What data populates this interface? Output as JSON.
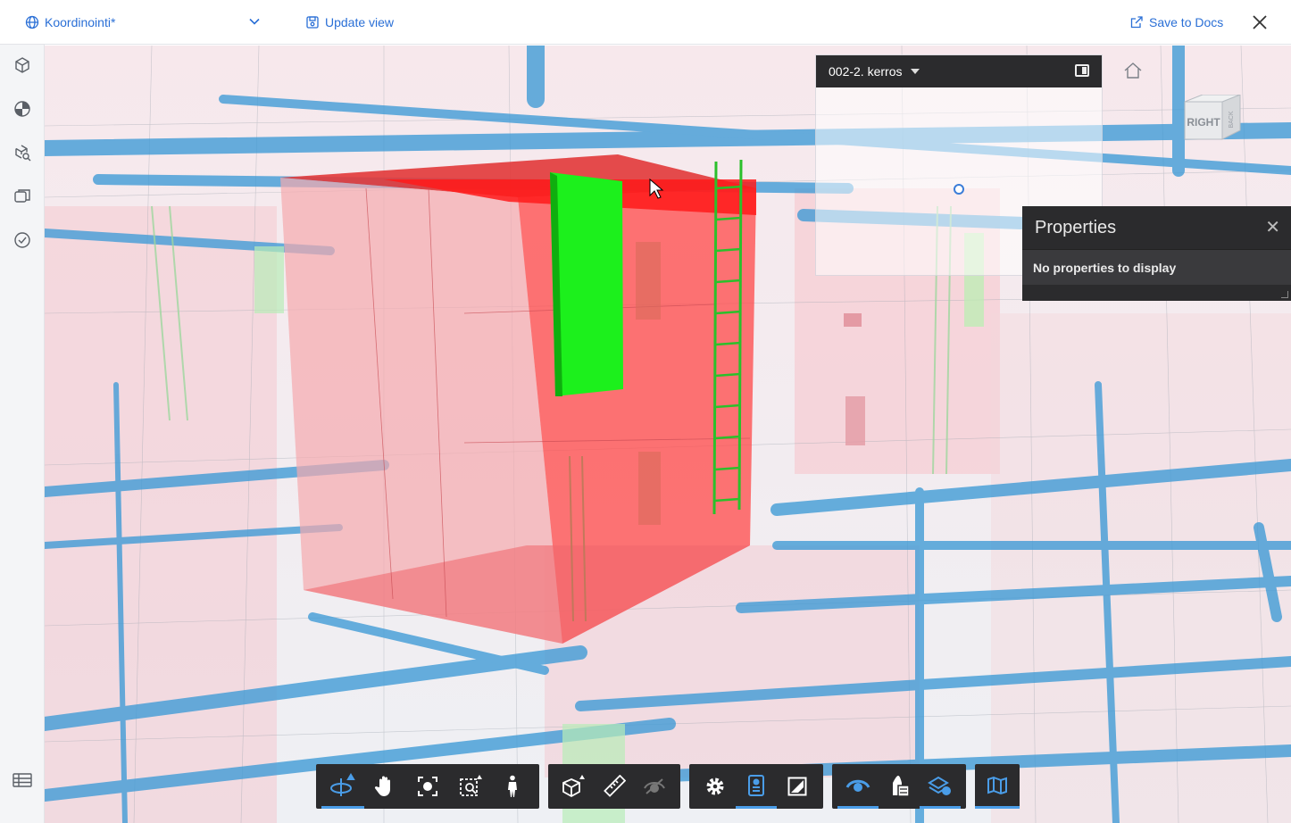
{
  "header": {
    "view_name": "Koordinointi*",
    "update_view_label": "Update view",
    "save_to_docs_label": "Save to Docs"
  },
  "minimap": {
    "level": "002-2. kerros"
  },
  "viewcube": {
    "front_label": "RIGHT",
    "side_label": "BACK"
  },
  "properties": {
    "title": "Properties",
    "empty_message": "No properties to display"
  },
  "sidebar": {
    "icons": [
      "model-cube-icon",
      "sphere-icon",
      "model-search-icon",
      "layers-icon",
      "check-circle-icon",
      "table-icon"
    ]
  },
  "toolbar": {
    "groups": [
      [
        "orbit-icon",
        "pan-hand-icon",
        "fit-view-icon",
        "zoom-window-icon",
        "first-person-icon"
      ],
      [
        "section-box-icon",
        "measure-ruler-icon",
        "hide-eye-icon"
      ],
      [
        "settings-gear-icon",
        "properties-icon",
        "fullscreen-icon"
      ],
      [
        "visibility-eye-icon",
        "model-browser-icon",
        "layers-view-icon"
      ],
      [
        "sheets-map-icon"
      ]
    ],
    "accent": "#4a9de8"
  },
  "colors": {
    "accent": "#2a6fd6",
    "highlight_red": "#ff2a2a",
    "highlight_green": "#1cf01c",
    "pipe_blue": "#3d9ad6"
  }
}
